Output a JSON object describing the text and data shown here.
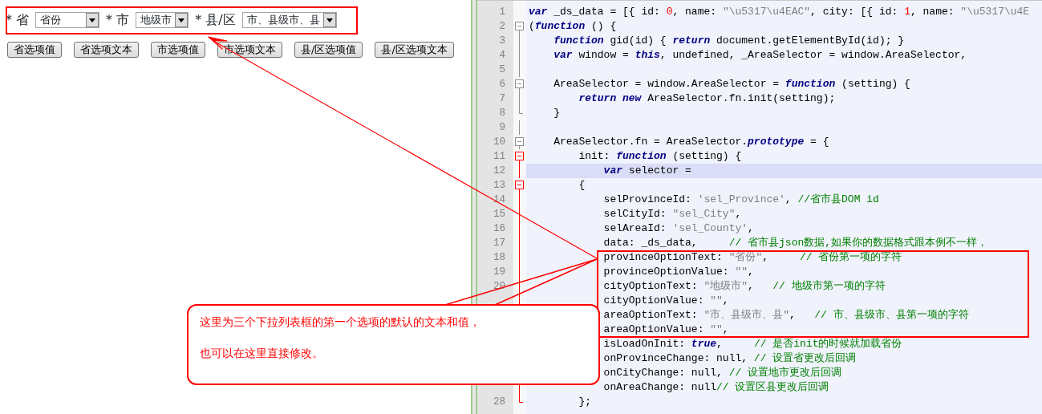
{
  "form": {
    "fields": [
      {
        "label": "* 省",
        "value": "省份"
      },
      {
        "label": "* 市",
        "value": "地级市"
      },
      {
        "label": "* 县/区",
        "value": "市、县级市、县"
      }
    ]
  },
  "buttons": [
    "省选项值",
    "省选项文本",
    "市选项值",
    "市选项文本",
    "县/区选项值",
    "县/区选项文本"
  ],
  "editor": {
    "lines": [
      {
        "number": "1",
        "kind": "plain",
        "current": false,
        "tokens": [
          {
            "kind": "keyword",
            "text": "var"
          },
          {
            "kind": "plain",
            "text": " _ds_data = [{ id: "
          },
          {
            "kind": "number",
            "text": "0"
          },
          {
            "kind": "plain",
            "text": ", name: "
          },
          {
            "kind": "string",
            "text": "\"\\u5317\\u4EAC\""
          },
          {
            "kind": "plain",
            "text": ", city: [{ id: "
          },
          {
            "kind": "number",
            "text": "1"
          },
          {
            "kind": "plain",
            "text": ", name: "
          },
          {
            "kind": "string",
            "text": "\"\\u5317\\u4E"
          }
        ]
      },
      {
        "number": "2",
        "kind": "fold-start",
        "fold_active": false,
        "current": false,
        "tokens": [
          {
            "kind": "plain",
            "text": "("
          },
          {
            "kind": "keyword",
            "text": "function"
          },
          {
            "kind": "plain",
            "text": " () {"
          }
        ]
      },
      {
        "number": "3",
        "kind": "fold-body",
        "fold_active": false,
        "current": false,
        "tokens": [
          {
            "kind": "keyword",
            "text": "    function"
          },
          {
            "kind": "plain",
            "text": " gid(id) { "
          },
          {
            "kind": "keyword",
            "text": "return"
          },
          {
            "kind": "plain",
            "text": " document.getElementById(id); }"
          }
        ]
      },
      {
        "number": "4",
        "kind": "fold-body",
        "fold_active": false,
        "current": false,
        "tokens": [
          {
            "kind": "keyword",
            "text": "    var"
          },
          {
            "kind": "plain",
            "text": " window = "
          },
          {
            "kind": "keyword",
            "text": "this"
          },
          {
            "kind": "plain",
            "text": ", undefined, _AreaSelector = window.AreaSelector,"
          }
        ]
      },
      {
        "number": "5",
        "kind": "fold-body",
        "fold_active": false,
        "current": false
      },
      {
        "number": "6",
        "kind": "fold-start",
        "fold_active": false,
        "current": false,
        "tokens": [
          {
            "kind": "plain",
            "text": "    AreaSelector = window.AreaSelector = "
          },
          {
            "kind": "keyword",
            "text": "function"
          },
          {
            "kind": "plain",
            "text": " (setting) {"
          }
        ]
      },
      {
        "number": "7",
        "kind": "fold-body",
        "fold_active": false,
        "current": false,
        "tokens": [
          {
            "kind": "keyword",
            "text": "        return new"
          },
          {
            "kind": "plain",
            "text": " AreaSelector.fn.init(setting);"
          }
        ]
      },
      {
        "number": "8",
        "kind": "fold-end",
        "fold_active": false,
        "current": false,
        "tokens": [
          {
            "kind": "plain",
            "text": "    }"
          }
        ]
      },
      {
        "number": "9",
        "kind": "fold-body",
        "fold_active": false,
        "current": false
      },
      {
        "number": "10",
        "kind": "fold-start",
        "fold_active": false,
        "current": false,
        "tokens": [
          {
            "kind": "plain",
            "text": "    AreaSelector.fn = AreaSelector."
          },
          {
            "kind": "keyword",
            "text": "prototype"
          },
          {
            "kind": "plain",
            "text": " = {"
          }
        ]
      },
      {
        "number": "11",
        "kind": "fold-start",
        "fold_active": true,
        "current": false,
        "tokens": [
          {
            "kind": "plain",
            "text": "        init: "
          },
          {
            "kind": "keyword",
            "text": "function"
          },
          {
            "kind": "plain",
            "text": " (setting) {"
          }
        ]
      },
      {
        "number": "12",
        "kind": "fold-body",
        "fold_active": true,
        "current": true,
        "tokens": [
          {
            "kind": "keyword",
            "text": "            var"
          },
          {
            "kind": "plain",
            "text": " selector ="
          }
        ]
      },
      {
        "number": "13",
        "kind": "fold-start",
        "fold_active": true,
        "current": false,
        "tokens": [
          {
            "kind": "plain",
            "text": "        {"
          }
        ]
      },
      {
        "number": "14",
        "kind": "fold-body",
        "fold_active": true,
        "current": false,
        "tokens": [
          {
            "kind": "plain",
            "text": "            selProvinceId: "
          },
          {
            "kind": "string",
            "text": "'sel_Province'"
          },
          {
            "kind": "plain",
            "text": ", "
          },
          {
            "kind": "comment",
            "text": "//省市县DOM id"
          }
        ]
      },
      {
        "number": "15",
        "kind": "fold-body",
        "fold_active": true,
        "current": false,
        "tokens": [
          {
            "kind": "plain",
            "text": "            selCityId: "
          },
          {
            "kind": "string",
            "text": "\"sel_City\""
          },
          {
            "kind": "plain",
            "text": ","
          }
        ]
      },
      {
        "number": "16",
        "kind": "fold-body",
        "fold_active": true,
        "current": false,
        "tokens": [
          {
            "kind": "plain",
            "text": "            selAreaId: "
          },
          {
            "kind": "string",
            "text": "'sel_County'"
          },
          {
            "kind": "plain",
            "text": ","
          }
        ]
      },
      {
        "number": "17",
        "kind": "fold-body",
        "fold_active": true,
        "current": false,
        "tokens": [
          {
            "kind": "plain",
            "text": "            data: _ds_data,     "
          },
          {
            "kind": "comment",
            "text": "// 省市县json数据,如果你的数据格式跟本例不一样，"
          }
        ]
      },
      {
        "number": "18",
        "kind": "fold-body",
        "fold_active": true,
        "current": false,
        "tokens": [
          {
            "kind": "plain",
            "text": "            provinceOptionText: "
          },
          {
            "kind": "string",
            "text": "\"省份\""
          },
          {
            "kind": "plain",
            "text": ",     "
          },
          {
            "kind": "comment",
            "text": "// 省份第一项的字符"
          }
        ]
      },
      {
        "number": "19",
        "kind": "fold-body",
        "fold_active": true,
        "current": false,
        "tokens": [
          {
            "kind": "plain",
            "text": "            provinceOptionValue: "
          },
          {
            "kind": "string",
            "text": "\"\""
          },
          {
            "kind": "plain",
            "text": ","
          }
        ]
      },
      {
        "number": "20",
        "kind": "fold-body",
        "fold_active": true,
        "current": false,
        "tokens": [
          {
            "kind": "plain",
            "text": "            cityOptionText: "
          },
          {
            "kind": "string",
            "text": "\"地级市\""
          },
          {
            "kind": "plain",
            "text": ",   "
          },
          {
            "kind": "comment",
            "text": "// 地级市第一项的字符"
          }
        ]
      },
      {
        "kind": "fold-body",
        "fold_active": true,
        "current": false,
        "tokens": [
          {
            "kind": "plain",
            "text": "            cityOptionValue: "
          },
          {
            "kind": "string",
            "text": "\"\""
          },
          {
            "kind": "plain",
            "text": ","
          }
        ]
      },
      {
        "current": false,
        "tokens": [
          {
            "kind": "plain",
            "text": "            areaOptionText: "
          },
          {
            "kind": "string",
            "text": "\"市、县级市、县\""
          },
          {
            "kind": "plain",
            "text": ",   "
          },
          {
            "kind": "comment",
            "text": "// 市、县级市、县第一项的字符"
          }
        ]
      },
      {
        "current": false,
        "tokens": [
          {
            "kind": "plain",
            "text": "            areaOptionValue: "
          },
          {
            "kind": "string",
            "text": "\"\""
          },
          {
            "kind": "plain",
            "text": ","
          }
        ]
      },
      {
        "current": false,
        "tokens": [
          {
            "kind": "plain",
            "text": "            isLoadOnInit: "
          },
          {
            "kind": "keyword",
            "text": "true"
          },
          {
            "kind": "plain",
            "text": ",     "
          },
          {
            "kind": "comment",
            "text": "// 是否init的时候就加载省份"
          }
        ]
      },
      {
        "current": false,
        "tokens": [
          {
            "kind": "plain",
            "text": "            onProvinceChange: null, "
          },
          {
            "kind": "comment",
            "text": "// 设置省更改后回调"
          }
        ]
      },
      {
        "current": false,
        "tokens": [
          {
            "kind": "plain",
            "text": "            onCityChange: null, "
          },
          {
            "kind": "comment",
            "text": "// 设置地市更改后回调"
          }
        ]
      },
      {
        "kind": "fold-body",
        "fold_active": true,
        "current": false,
        "tokens": [
          {
            "kind": "plain",
            "text": "            onAreaChange: null"
          },
          {
            "kind": "comment",
            "text": "// 设置区县更改后回调"
          }
        ]
      },
      {
        "number": "28",
        "kind": "fold-end",
        "fold_active": true,
        "current": false,
        "tokens": [
          {
            "kind": "plain",
            "text": "        };"
          }
        ]
      }
    ]
  },
  "callout": {
    "paragraphs": [
      "这里为三个下拉列表框的第一个选项的默认的文本和值，",
      "也可以在这里直接修改。"
    ]
  }
}
